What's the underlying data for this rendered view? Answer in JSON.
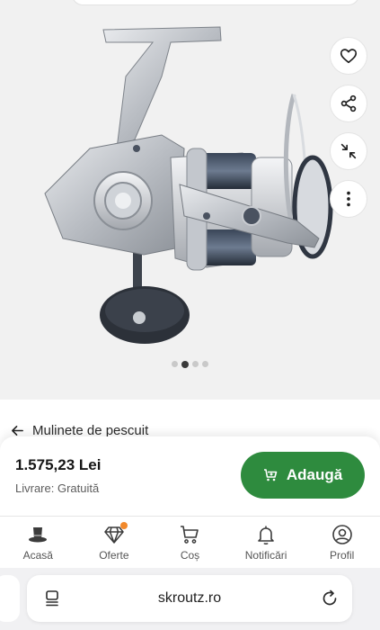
{
  "product": {
    "image_alt": "spinning-reel",
    "gallery_dots": [
      false,
      true,
      false,
      false
    ]
  },
  "side_actions": [
    {
      "name": "favorite-button",
      "icon": "heart-icon"
    },
    {
      "name": "share-button",
      "icon": "share-icon"
    },
    {
      "name": "collapse-button",
      "icon": "minimize-icon"
    },
    {
      "name": "more-button",
      "icon": "more-vertical-icon"
    }
  ],
  "breadcrumb": {
    "label": "Mulinete de pescuit"
  },
  "buy": {
    "price": "1.575,23 Lei",
    "delivery": "Livrare: Gratuită",
    "add_label": "Adaugă",
    "accent": "#2e8b3e"
  },
  "nav": {
    "items": [
      {
        "label": "Acasă",
        "icon": "hat-icon"
      },
      {
        "label": "Oferte",
        "icon": "diamond-icon"
      },
      {
        "label": "Coș",
        "icon": "cart-icon"
      },
      {
        "label": "Notificări",
        "icon": "bell-icon"
      },
      {
        "label": "Profil",
        "icon": "user-icon"
      }
    ],
    "badge_color": "#f2892b"
  },
  "browser": {
    "url": "skroutz.ro"
  }
}
